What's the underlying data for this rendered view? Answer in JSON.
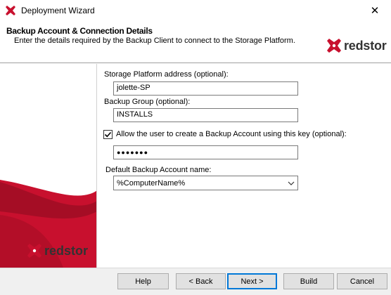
{
  "window": {
    "title": "Deployment Wizard",
    "close_glyph": "✕"
  },
  "header": {
    "title": "Backup Account & Connection Details",
    "subtitle": "Enter the details required by the Backup Client to connect to the Storage Platform.",
    "logo_text": "redstor"
  },
  "sidebar": {
    "logo_text": "redstor"
  },
  "form": {
    "storage_platform": {
      "label": "Storage Platform address (optional):",
      "value": "jolette-SP"
    },
    "backup_group": {
      "label": "Backup Group (optional):",
      "value": "INSTALLS"
    },
    "allow_create": {
      "label": "Allow the user to create a Backup Account using this key (optional):",
      "checked": true
    },
    "key": {
      "value": "●●●●●●●"
    },
    "default_account": {
      "label": "Default Backup Account name:",
      "value": "%ComputerName%"
    }
  },
  "buttons": {
    "help": "Help",
    "back": "< Back",
    "next": "Next >",
    "build": "Build",
    "cancel": "Cancel"
  },
  "colors": {
    "brand_red": "#c8102e",
    "accent_blue": "#0078d7"
  },
  "icons": [
    "app-icon",
    "close-icon",
    "redstor-logo-icon",
    "checkmark-icon",
    "chevron-down-icon"
  ]
}
